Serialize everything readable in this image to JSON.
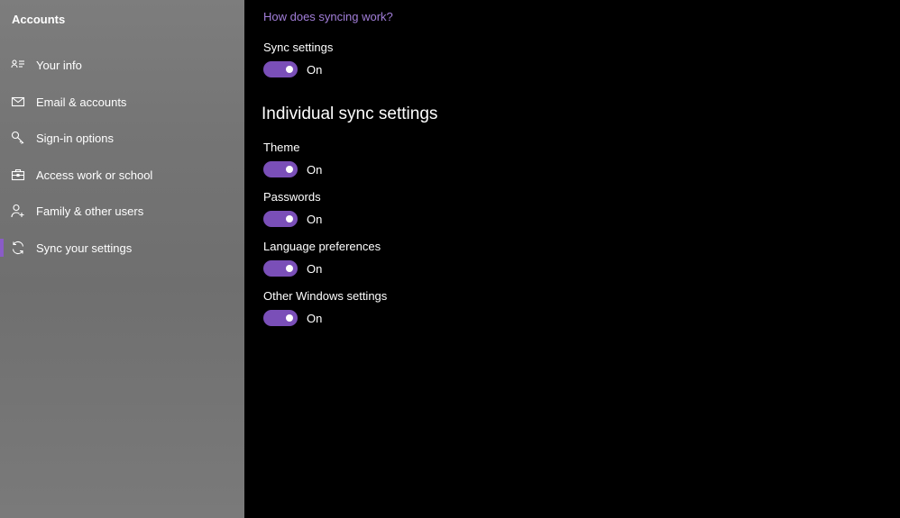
{
  "sidebar": {
    "title": "Accounts",
    "items": [
      {
        "label": "Your info",
        "icon": "contact-card-icon"
      },
      {
        "label": "Email & accounts",
        "icon": "mail-icon"
      },
      {
        "label": "Sign-in options",
        "icon": "key-icon"
      },
      {
        "label": "Access work or school",
        "icon": "briefcase-icon"
      },
      {
        "label": "Family & other users",
        "icon": "person-add-icon"
      },
      {
        "label": "Sync your settings",
        "icon": "sync-icon",
        "active": true
      }
    ]
  },
  "main": {
    "help_link": "How does syncing work?",
    "sync_settings": {
      "label": "Sync settings",
      "state": "On"
    },
    "individual_heading": "Individual sync settings",
    "individual": [
      {
        "label": "Theme",
        "state": "On"
      },
      {
        "label": "Passwords",
        "state": "On"
      },
      {
        "label": "Language preferences",
        "state": "On"
      },
      {
        "label": "Other Windows settings",
        "state": "On"
      }
    ]
  },
  "colors": {
    "accent": "#7a4fb8",
    "link": "#a27ed9",
    "background": "#000000",
    "sidebar": "#767676"
  }
}
